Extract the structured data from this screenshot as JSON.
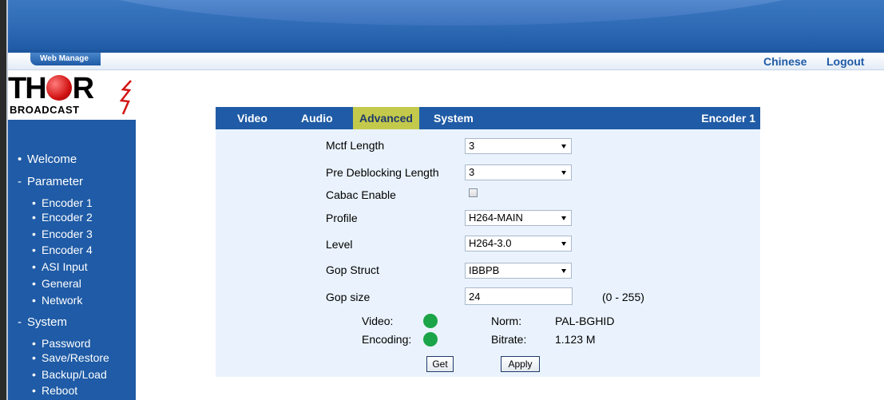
{
  "header": {
    "web_manage_label": "Web Manage",
    "links": {
      "chinese": "Chinese",
      "logout": "Logout"
    }
  },
  "logo": {
    "title_left": "TH",
    "title_right": "R",
    "subtitle": "BROADCAST"
  },
  "sidebar": {
    "welcome": "Welcome",
    "parameter": "Parameter",
    "parameter_items": [
      "Encoder 1",
      "Encoder 2",
      "Encoder 3",
      "Encoder 4",
      "ASI Input",
      "General",
      "Network"
    ],
    "system": "System",
    "system_items": [
      "Password",
      "Save/Restore",
      "Backup/Load",
      "Reboot"
    ],
    "bullet": "•",
    "expanded_marker": "-"
  },
  "tabs": {
    "items": [
      "Video",
      "Audio",
      "Advanced",
      "System"
    ],
    "active": "Advanced",
    "encoder_title": "Encoder 1"
  },
  "form": {
    "mctf_length": {
      "label": "Mctf Length",
      "value": "3"
    },
    "pre_deblocking_length": {
      "label": "Pre Deblocking Length",
      "value": "3"
    },
    "cabac_enable": {
      "label": "Cabac Enable",
      "checked": false
    },
    "profile": {
      "label": "Profile",
      "value": "H264-MAIN"
    },
    "level": {
      "label": "Level",
      "value": "H264-3.0"
    },
    "gop_struct": {
      "label": "Gop Struct",
      "value": "IBBPB"
    },
    "gop_size": {
      "label": "Gop size",
      "value": "24",
      "range": "(0 - 255)"
    }
  },
  "status": {
    "video_label": "Video:",
    "encoding_label": "Encoding:",
    "norm_label": "Norm:",
    "norm_value": "PAL-BGHID",
    "bitrate_label": "Bitrate:",
    "bitrate_value": "1.123 M",
    "indicator_color": "#1ca548"
  },
  "buttons": {
    "get": "Get",
    "apply": "Apply"
  },
  "colors": {
    "primary_blue": "#1f5ba6",
    "active_tab": "#c3c94a",
    "panel_bg": "#eaf3fd"
  }
}
